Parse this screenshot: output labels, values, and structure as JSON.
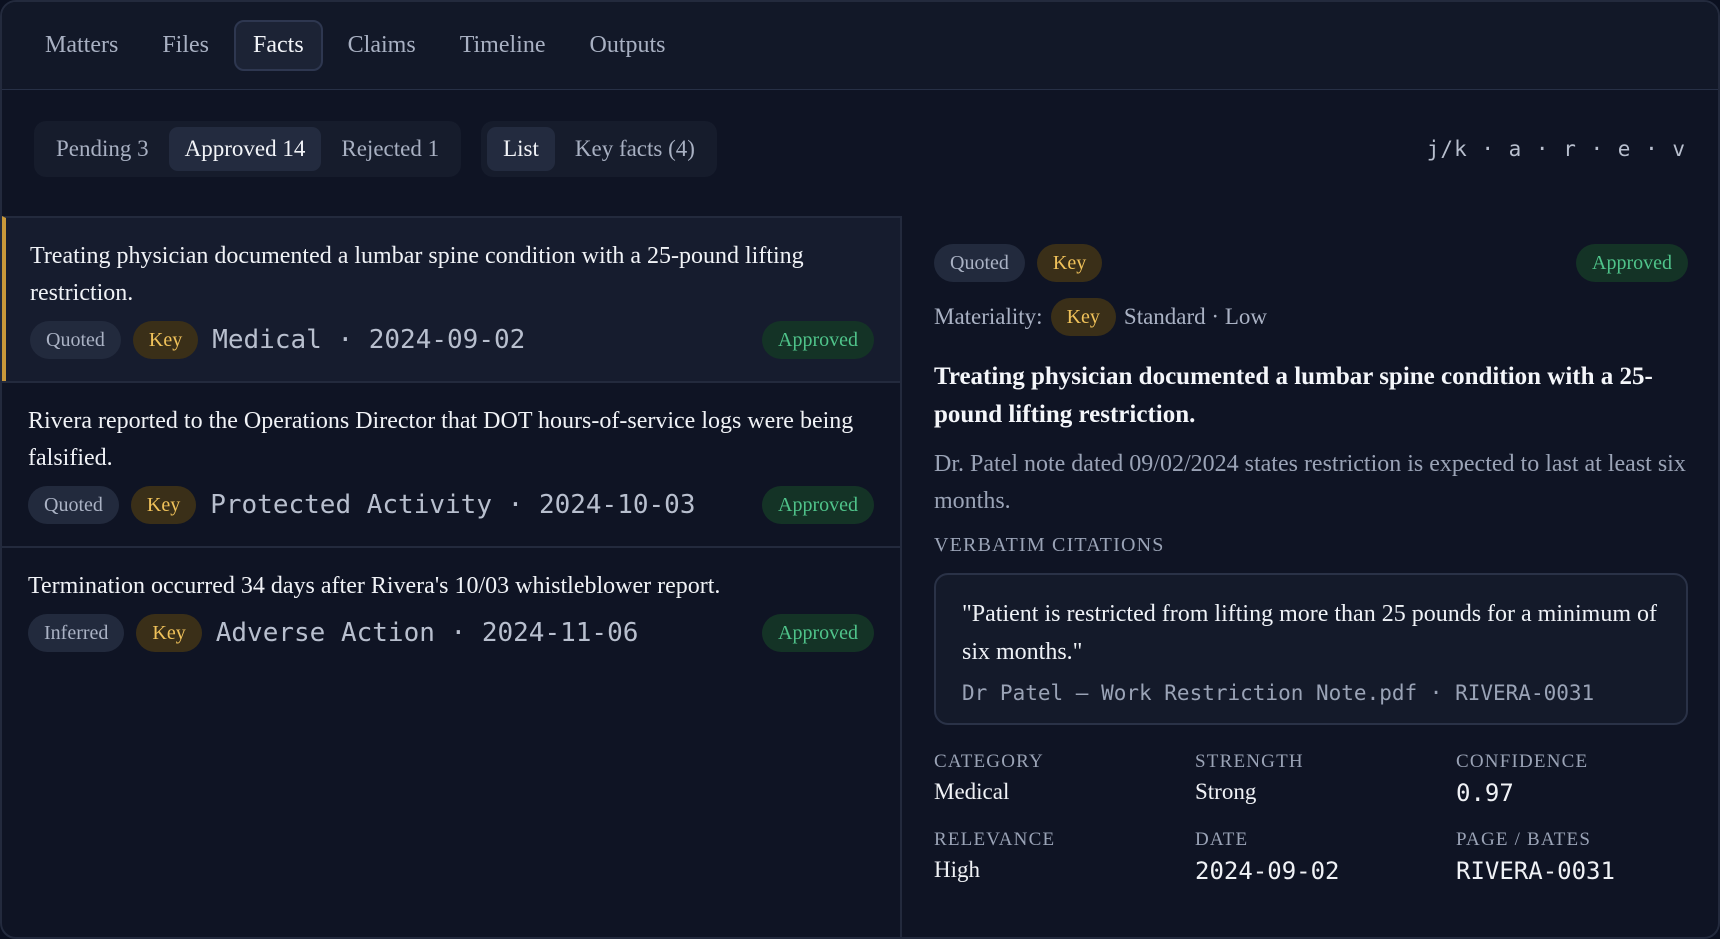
{
  "nav": {
    "tabs": [
      {
        "label": "Matters"
      },
      {
        "label": "Files"
      },
      {
        "label": "Facts"
      },
      {
        "label": "Claims"
      },
      {
        "label": "Timeline"
      },
      {
        "label": "Outputs"
      }
    ],
    "active": "Facts"
  },
  "filters": {
    "status": [
      {
        "label": "Pending 3"
      },
      {
        "label": "Approved 14"
      },
      {
        "label": "Rejected 1"
      }
    ],
    "views": [
      {
        "label": "List"
      },
      {
        "label": "Key facts (4)"
      }
    ],
    "shortcuts": "j/k · a · r · e · v"
  },
  "facts": [
    {
      "text": "Treating physician documented a lumbar spine condition with a 25-pound lifting restriction.",
      "kind": "Quoted",
      "key": "Key",
      "meta": "Medical · 2024-09-02",
      "status": "Approved"
    },
    {
      "text": "Rivera reported to the Operations Director that DOT hours-of-service logs were being falsified.",
      "kind": "Quoted",
      "key": "Key",
      "meta": "Protected Activity · 2024-10-03",
      "status": "Approved"
    },
    {
      "text": "Termination occurred 34 days after Rivera's 10/03 whistleblower report.",
      "kind": "Inferred",
      "key": "Key",
      "meta": "Adverse Action · 2024-11-06",
      "status": "Approved"
    }
  ],
  "detail": {
    "kind": "Quoted",
    "key": "Key",
    "status": "Approved",
    "materiality_label": "Materiality:",
    "materiality_key": "Key",
    "materiality_rest": "Standard · Low",
    "title": "Treating physician documented a lumbar spine condition with a 25-pound lifting restriction.",
    "note": "Dr. Patel note dated 09/02/2024 states restriction is expected to last at least six months.",
    "citations_label": "VERBATIM CITATIONS",
    "citation": {
      "quote": "\"Patient is restricted from lifting more than 25 pounds for a minimum of six months.\"",
      "source": "Dr Patel — Work Restriction Note.pdf · RIVERA-0031"
    },
    "fields": {
      "category_label": "CATEGORY",
      "category": "Medical",
      "strength_label": "STRENGTH",
      "strength": "Strong",
      "confidence_label": "CONFIDENCE",
      "confidence": "0.97",
      "relevance_label": "RELEVANCE",
      "relevance": "High",
      "date_label": "DATE",
      "date": "2024-09-02",
      "page_label": "PAGE / BATES",
      "page": "RIVERA-0031"
    }
  },
  "colors": {
    "accent_selected": "#c9983a",
    "key_badge": "#f0c25a",
    "approved": "#4fc38a"
  }
}
